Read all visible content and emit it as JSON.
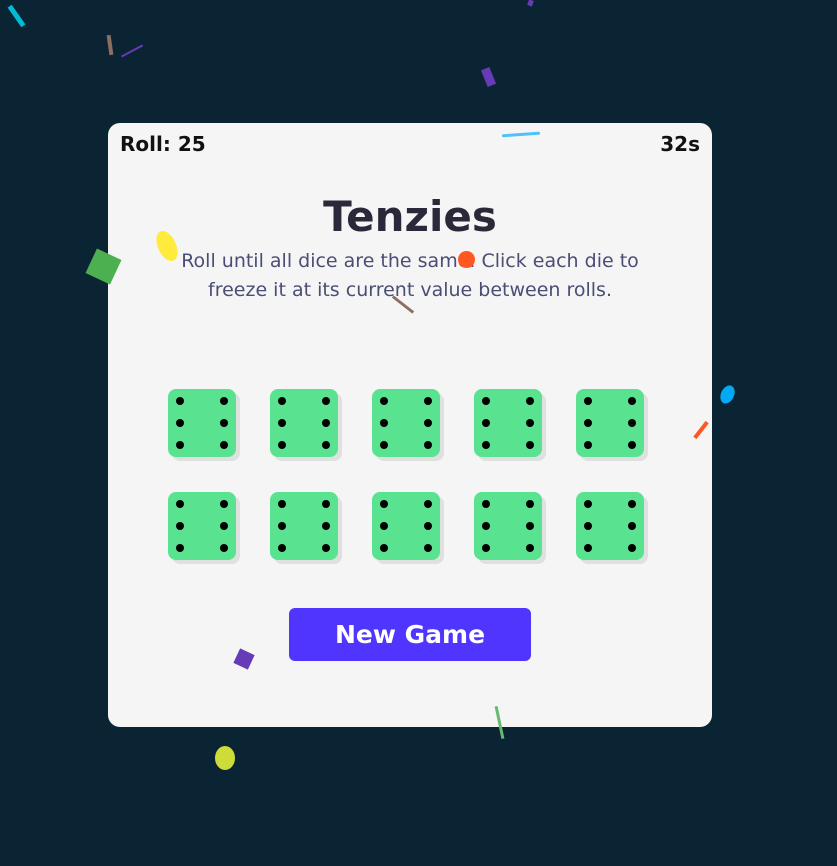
{
  "game": {
    "roll_label": "Roll: 25",
    "time_label": "32s",
    "title": "Tenzies",
    "instructions": "Roll until all dice are the same. Click each die to freeze it at its current value between rolls.",
    "new_game_label": "New Game",
    "dice": [
      {
        "value": 6,
        "held": true
      },
      {
        "value": 6,
        "held": true
      },
      {
        "value": 6,
        "held": true
      },
      {
        "value": 6,
        "held": true
      },
      {
        "value": 6,
        "held": true
      },
      {
        "value": 6,
        "held": true
      },
      {
        "value": 6,
        "held": true
      },
      {
        "value": 6,
        "held": true
      },
      {
        "value": 6,
        "held": true
      },
      {
        "value": 6,
        "held": true
      }
    ]
  },
  "colors": {
    "background": "#0b2434",
    "card": "#f5f5f5",
    "die_held": "#59e391",
    "button": "#5035ff",
    "title": "#2b283a",
    "instructions": "#4a4e74"
  },
  "confetti_colors": [
    "#00bcd4",
    "#8d6e63",
    "#673ab7",
    "#4fc3f7",
    "#ffeb3b",
    "#4caf50",
    "#ff5722",
    "#03a9f4",
    "#cddc39",
    "#66bb6a"
  ]
}
